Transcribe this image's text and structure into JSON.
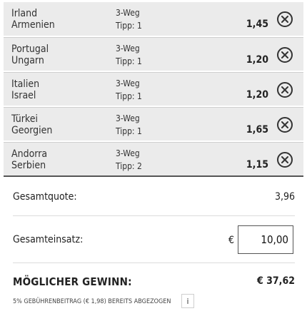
{
  "bets": [
    {
      "home": "Irland",
      "away": "Armenien",
      "market": "3-Weg",
      "tip": "Tipp: 1",
      "odds": "1,45"
    },
    {
      "home": "Portugal",
      "away": "Ungarn",
      "market": "3-Weg",
      "tip": "Tipp: 1",
      "odds": "1,20"
    },
    {
      "home": "Italien",
      "away": "Israel",
      "market": "3-Weg",
      "tip": "Tipp: 1",
      "odds": "1,20"
    },
    {
      "home": "Türkei",
      "away": "Georgien",
      "market": "3-Weg",
      "tip": "Tipp: 1",
      "odds": "1,65"
    },
    {
      "home": "Andorra",
      "away": "Serbien",
      "market": "3-Weg",
      "tip": "Tipp: 2",
      "odds": "1,15"
    }
  ],
  "summary": {
    "total_odds_label": "Gesamtquote:",
    "total_odds_value": "3,96",
    "stake_label": "Gesamteinsatz:",
    "currency": "€",
    "stake_value": "10,00",
    "win_label": "MÖGLICHER GEWINN:",
    "win_value": "€ 37,62",
    "fee_note": "5% GEBÜHRENBEITRAG (€ 1,98) BEREITS ABGEZOGEN",
    "info_label": "i"
  },
  "icons": {
    "remove": "close-circle-icon",
    "info": "info-icon"
  }
}
